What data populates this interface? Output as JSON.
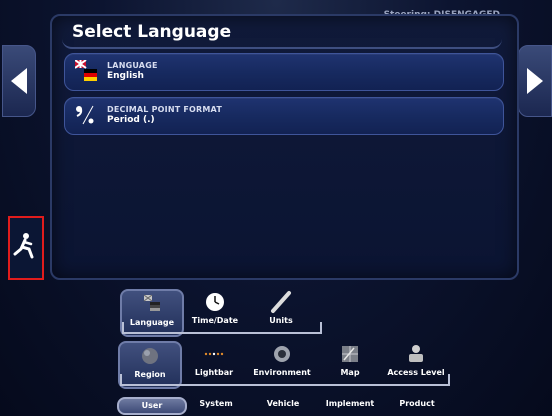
{
  "status": {
    "text": "Steering: DISENGAGED"
  },
  "page": {
    "title": "Select Language"
  },
  "settings": [
    {
      "label": "LANGUAGE",
      "value": "English",
      "icon": "flag-icon"
    },
    {
      "label": "DECIMAL POINT FORMAT",
      "value": "Period (.)",
      "icon": "decimal-point-icon"
    }
  ],
  "tabs_row1": [
    {
      "label": "Language",
      "icon": "language-flag-icon",
      "selected": true
    },
    {
      "label": "Time/Date",
      "icon": "clock-icon",
      "selected": false
    },
    {
      "label": "Units",
      "icon": "ruler-icon",
      "selected": false
    }
  ],
  "tabs_row2": [
    {
      "label": "Region",
      "icon": "globe-icon",
      "selected": true
    },
    {
      "label": "Lightbar",
      "icon": "lightbar-icon",
      "selected": false
    },
    {
      "label": "Environment",
      "icon": "speaker-icon",
      "selected": false
    },
    {
      "label": "Map",
      "icon": "map-icon",
      "selected": false
    },
    {
      "label": "Access Level",
      "icon": "user-icon",
      "selected": false
    }
  ],
  "tabs_row3": [
    {
      "label": "User",
      "selected": true
    },
    {
      "label": "System",
      "selected": false
    },
    {
      "label": "Vehicle",
      "selected": false
    },
    {
      "label": "Implement",
      "selected": false
    },
    {
      "label": "Product",
      "selected": false
    }
  ],
  "colors": {
    "highlight": "#e11c1c",
    "row_bg": "#1f3370",
    "background": "#0c1430"
  }
}
